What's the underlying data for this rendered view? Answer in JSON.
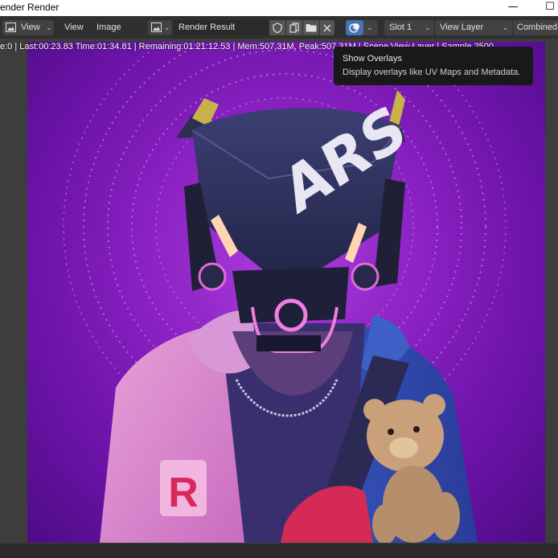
{
  "window": {
    "title": "ender Render"
  },
  "header": {
    "view_menu_1": "View",
    "view_menu_2": "View",
    "image_menu": "Image",
    "image_name": "Render Result",
    "slot": "Slot 1",
    "layer": "View Layer",
    "pass": "Combined"
  },
  "stats": {
    "text": "e:0 | Last:00:23.83 Time:01:34.81 | Remaining:01:21:12.53 | Mem:507.31M, Peak:507.31M | Scene View Layer | Sample 2500"
  },
  "tooltip": {
    "title": "Show Overlays",
    "description": "Display overlays like UV Maps and Metadata."
  },
  "render_image": {
    "helmet_text": "ARS",
    "jacket_letter": "R"
  },
  "icons": {
    "view_mode": "image-editor-icon",
    "image_browse": "image-browse-icon",
    "fake_user": "shield-icon",
    "duplicate": "duplicate-icon",
    "open": "folder-icon",
    "unlink": "close-icon",
    "overlays": "overlays-icon"
  }
}
